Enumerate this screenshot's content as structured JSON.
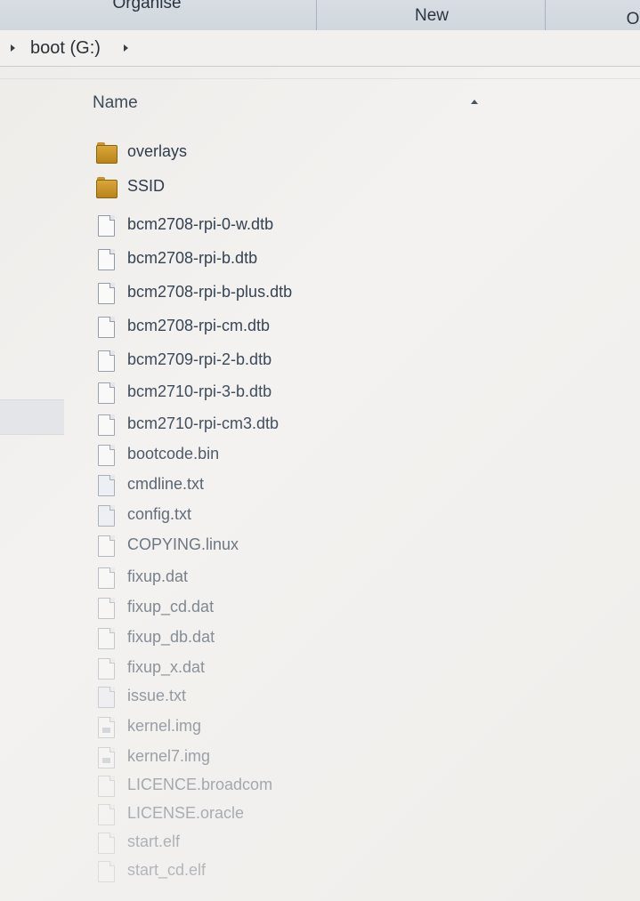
{
  "toolbar": {
    "organise_label": "Organise",
    "new_label": "New",
    "more_label": "O"
  },
  "address": {
    "crumb": "boot (G:)"
  },
  "columns": {
    "name": "Name"
  },
  "files": [
    {
      "name": "overlays",
      "type": "folder",
      "icon": "folder-icon"
    },
    {
      "name": "SSID",
      "type": "folder",
      "icon": "folder-icon"
    },
    {
      "name": "bcm2708-rpi-0-w.dtb",
      "type": "file",
      "icon": "file-icon"
    },
    {
      "name": "bcm2708-rpi-b.dtb",
      "type": "file",
      "icon": "file-icon"
    },
    {
      "name": "bcm2708-rpi-b-plus.dtb",
      "type": "file",
      "icon": "file-icon"
    },
    {
      "name": "bcm2708-rpi-cm.dtb",
      "type": "file",
      "icon": "file-icon"
    },
    {
      "name": "bcm2709-rpi-2-b.dtb",
      "type": "file",
      "icon": "file-icon"
    },
    {
      "name": "bcm2710-rpi-3-b.dtb",
      "type": "file",
      "icon": "file-icon"
    },
    {
      "name": "bcm2710-rpi-cm3.dtb",
      "type": "file",
      "icon": "file-icon"
    },
    {
      "name": "bootcode.bin",
      "type": "file",
      "icon": "file-icon"
    },
    {
      "name": "cmdline.txt",
      "type": "file",
      "icon": "text-file-icon"
    },
    {
      "name": "config.txt",
      "type": "file",
      "icon": "text-file-icon"
    },
    {
      "name": "COPYING.linux",
      "type": "file",
      "icon": "file-icon"
    },
    {
      "name": "fixup.dat",
      "type": "file",
      "icon": "file-icon"
    },
    {
      "name": "fixup_cd.dat",
      "type": "file",
      "icon": "file-icon"
    },
    {
      "name": "fixup_db.dat",
      "type": "file",
      "icon": "file-icon"
    },
    {
      "name": "fixup_x.dat",
      "type": "file",
      "icon": "file-icon"
    },
    {
      "name": "issue.txt",
      "type": "file",
      "icon": "text-file-icon"
    },
    {
      "name": "kernel.img",
      "type": "file",
      "icon": "image-file-icon"
    },
    {
      "name": "kernel7.img",
      "type": "file",
      "icon": "image-file-icon"
    },
    {
      "name": "LICENCE.broadcom",
      "type": "file",
      "icon": "file-icon"
    },
    {
      "name": "LICENSE.oracle",
      "type": "file",
      "icon": "file-icon"
    },
    {
      "name": "start.elf",
      "type": "file",
      "icon": "file-icon"
    },
    {
      "name": "start_cd.elf",
      "type": "file",
      "icon": "file-icon"
    }
  ]
}
